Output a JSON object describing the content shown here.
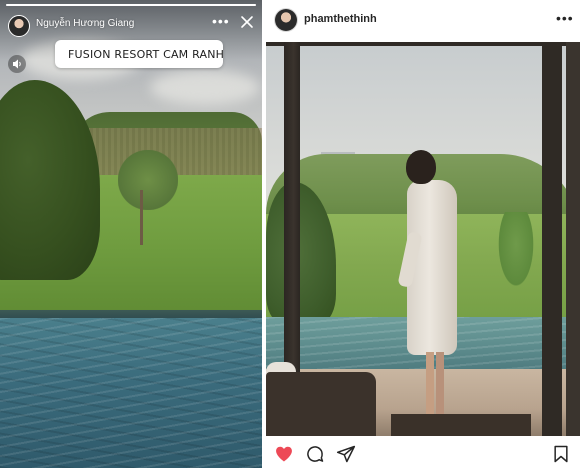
{
  "story": {
    "username": "Nguyễn Hương Giang",
    "location_sticker": "FUSION RESORT CAM RANH",
    "progress": 1.0,
    "icons": {
      "more": "more-horizontal-icon",
      "close": "close-icon",
      "sound": "speaker-icon",
      "pin": "location-pin-icon"
    }
  },
  "post": {
    "username": "phamthethinh",
    "icons": {
      "more": "more-horizontal-icon",
      "like": "heart-icon",
      "comment": "comment-icon",
      "share": "send-icon",
      "save": "bookmark-icon"
    },
    "liked": true
  },
  "colors": {
    "like_red": "#ed4956",
    "sticker_pin": "#3fb5c7",
    "username_text": "#262626"
  }
}
